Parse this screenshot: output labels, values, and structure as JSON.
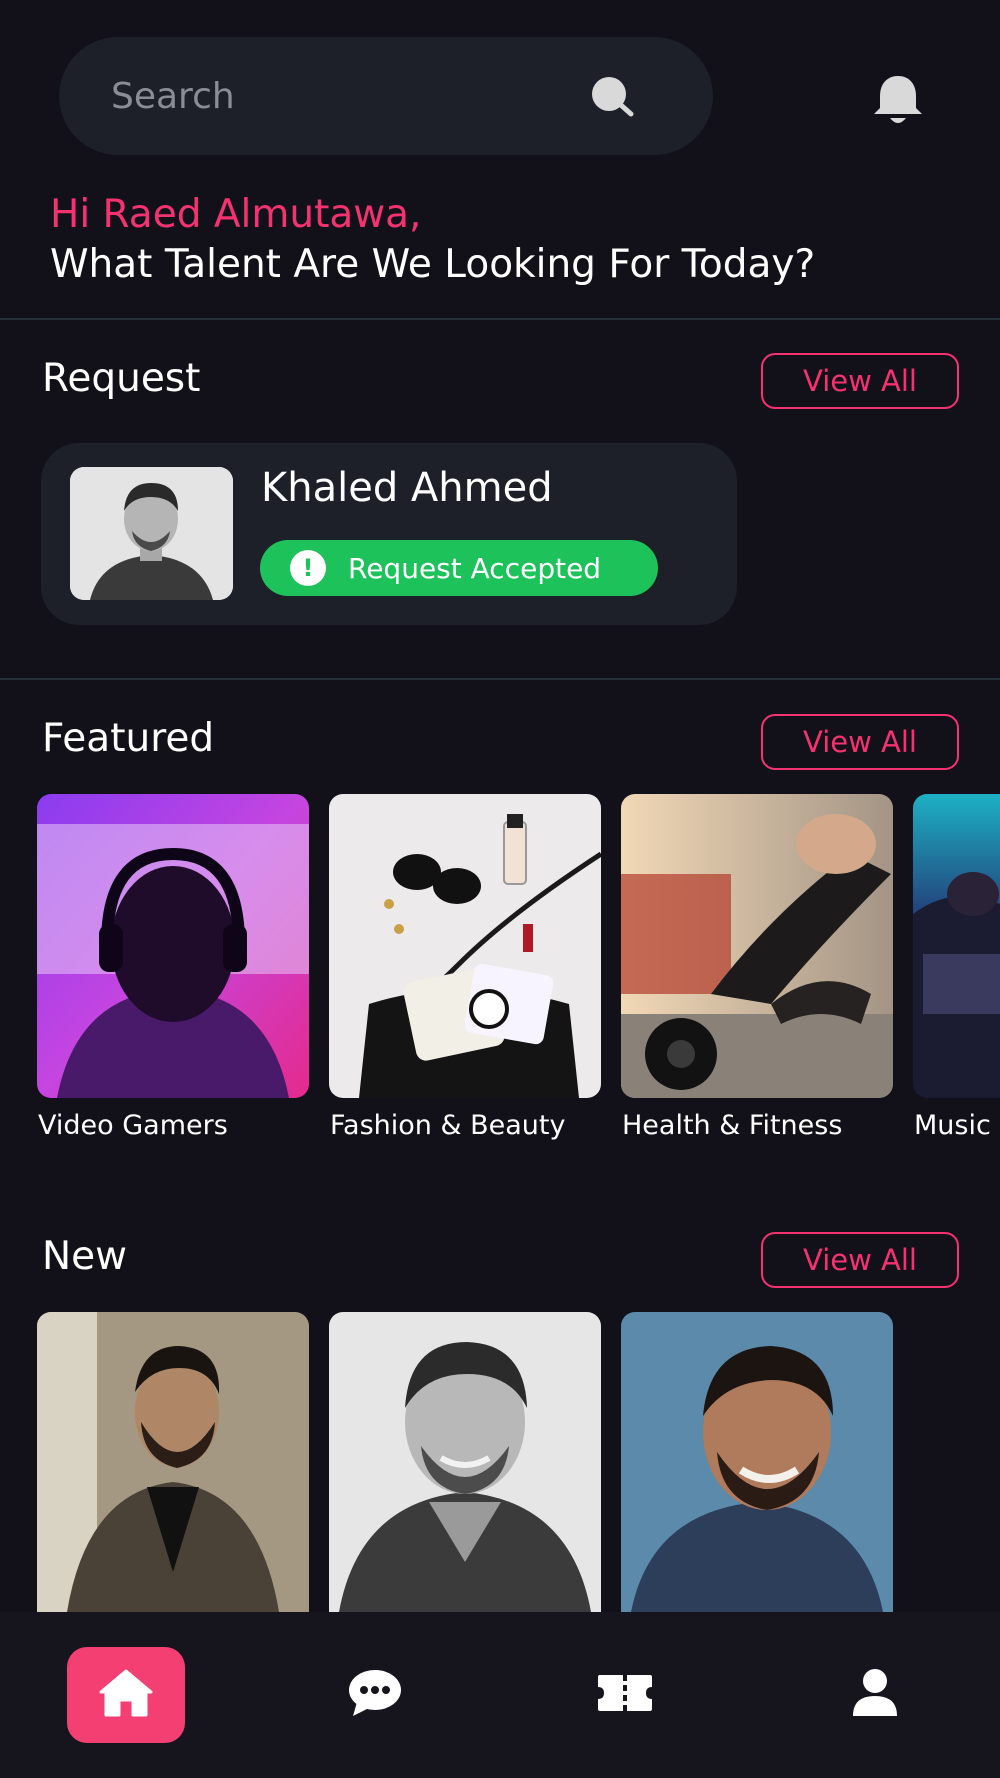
{
  "search": {
    "placeholder": "Search"
  },
  "greeting": {
    "hello": "Hi Raed Almutawa,",
    "question": "What Talent Are We Looking For Today?"
  },
  "request": {
    "title": "Request",
    "view_all": "View All",
    "name": "Khaled Ahmed",
    "status": "Request Accepted"
  },
  "featured": {
    "title": "Featured",
    "view_all": "View All",
    "items": [
      {
        "label": "Video Gamers"
      },
      {
        "label": "Fashion & Beauty"
      },
      {
        "label": "Health & Fitness"
      },
      {
        "label": "Music"
      }
    ]
  },
  "new": {
    "title": "New",
    "view_all": "View All"
  },
  "colors": {
    "accent": "#f4326f",
    "success": "#1ec25b",
    "background": "#12111a",
    "card": "#1d1f29"
  },
  "nav": {
    "items": [
      {
        "icon": "home-icon",
        "active": true
      },
      {
        "icon": "chat-icon",
        "active": false
      },
      {
        "icon": "ticket-icon",
        "active": false
      },
      {
        "icon": "profile-icon",
        "active": false
      }
    ]
  }
}
